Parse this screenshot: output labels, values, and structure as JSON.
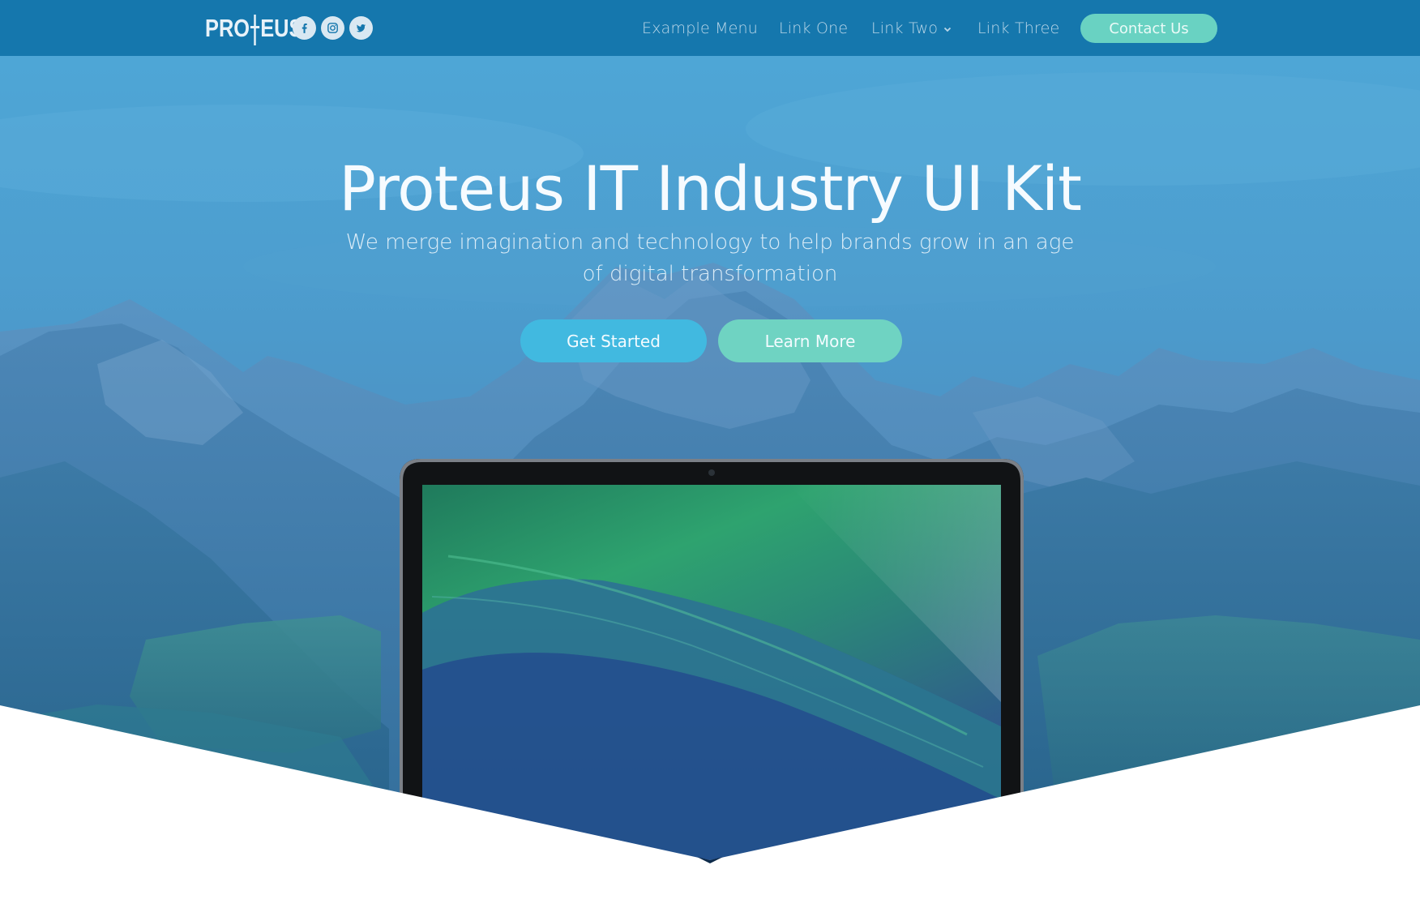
{
  "brand": {
    "logo_text": "PRO EUS",
    "socials": [
      {
        "icon": "facebook-icon"
      },
      {
        "icon": "instagram-icon"
      },
      {
        "icon": "twitter-icon"
      }
    ]
  },
  "nav": {
    "items": [
      {
        "label": "Example Menu"
      },
      {
        "label": "Link One"
      },
      {
        "label": "Link Two",
        "icon": "chevron-down-icon"
      },
      {
        "label": "Link Three"
      }
    ],
    "contact_label": "Contact Us"
  },
  "hero": {
    "title": "Proteus  IT  Industry UI  Kit",
    "subtitle": "We merge imagination and technology to help brands grow in an age of digital transformation",
    "primary_label": "Get Started",
    "secondary_label": "Learn More"
  },
  "colors": {
    "navbar": "#1577ad",
    "overlay": "#3a9ad0",
    "primary_button": "#41b9e0",
    "secondary_button": "#6fd3c2",
    "contact_button": "#69d2c2"
  }
}
